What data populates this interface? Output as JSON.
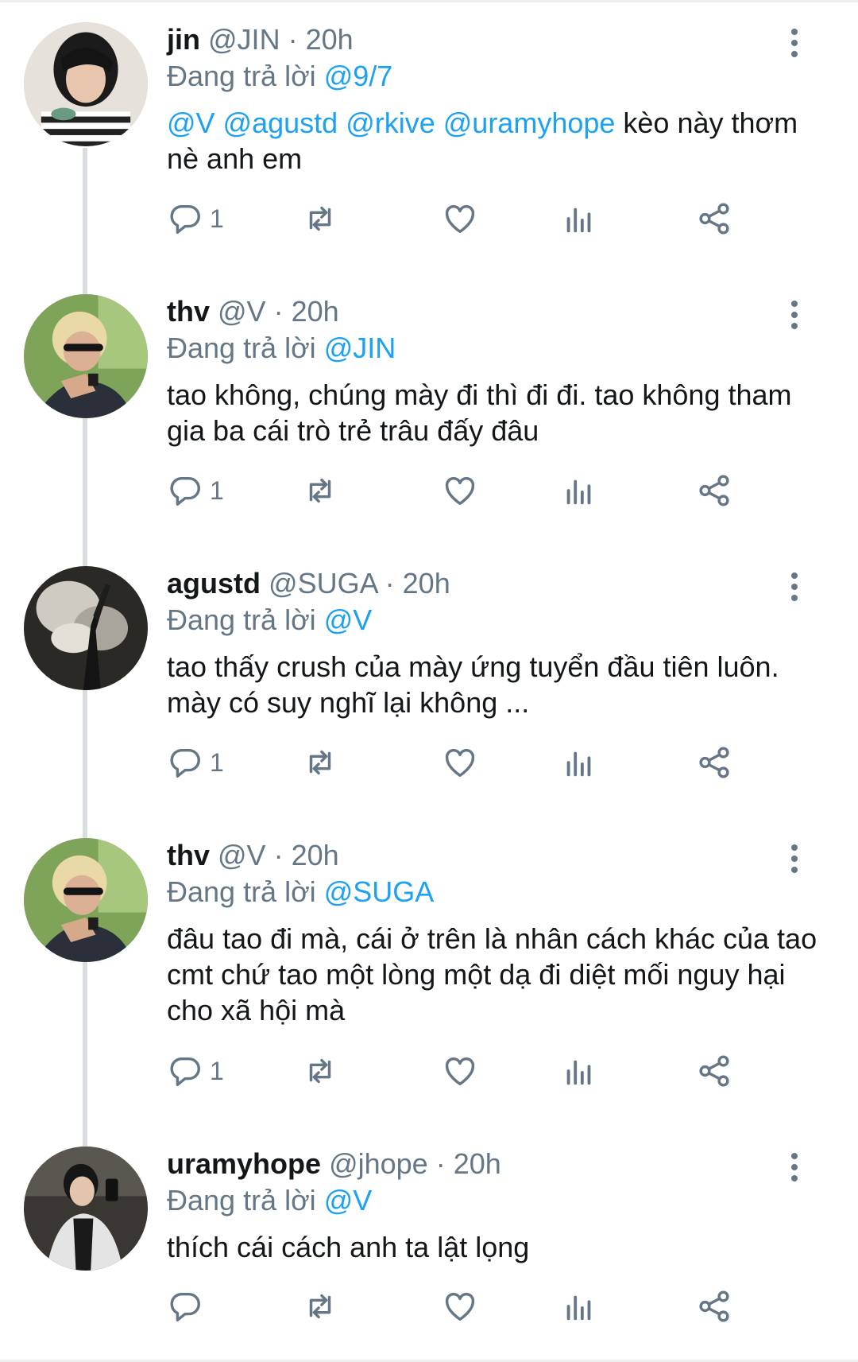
{
  "tweets": [
    {
      "name": "jin",
      "handle": "@JIN",
      "time": "20h",
      "reply_prefix": "Đang trả lời",
      "reply_to": "@9/7",
      "body_mentions": "@V @agustd @rkive @uramyhope",
      "body_text": " kèo này thơm nè anh em",
      "reply_count": "1"
    },
    {
      "name": "thv",
      "handle": "@V",
      "time": "20h",
      "reply_prefix": "Đang trả lời",
      "reply_to": "@JIN",
      "body_mentions": "",
      "body_text": "tao không, chúng mày đi thì đi đi. tao không tham gia ba cái trò trẻ trâu đấy đâu",
      "reply_count": "1"
    },
    {
      "name": "agustd",
      "handle": "@SUGA",
      "time": "20h",
      "reply_prefix": "Đang trả lời",
      "reply_to": "@V",
      "body_mentions": "",
      "body_text": "tao thấy crush của mày ứng tuyển đầu tiên luôn. mày có suy nghĩ lại không ...",
      "reply_count": "1"
    },
    {
      "name": "thv",
      "handle": "@V",
      "time": "20h",
      "reply_prefix": "Đang trả lời",
      "reply_to": "@SUGA",
      "body_mentions": "",
      "body_text": "đâu tao đi mà, cái ở trên là nhân cách khác của tao cmt chứ tao một lòng một dạ đi diệt mối nguy hại cho xã hội mà",
      "reply_count": "1"
    },
    {
      "name": "uramyhope",
      "handle": "@jhope",
      "time": "20h",
      "reply_prefix": "Đang trả lời",
      "reply_to": "@V",
      "body_mentions": "",
      "body_text": "thích cái cách anh ta lật lọng",
      "reply_count": ""
    }
  ],
  "separator": "·",
  "icons": [
    "reply-icon",
    "retweet-icon",
    "like-icon",
    "analytics-icon",
    "share-icon",
    "more-icon"
  ],
  "colors": {
    "accent": "#1da1f2",
    "muted": "#657786",
    "text": "#14171a",
    "thread": "#d9dde1"
  }
}
